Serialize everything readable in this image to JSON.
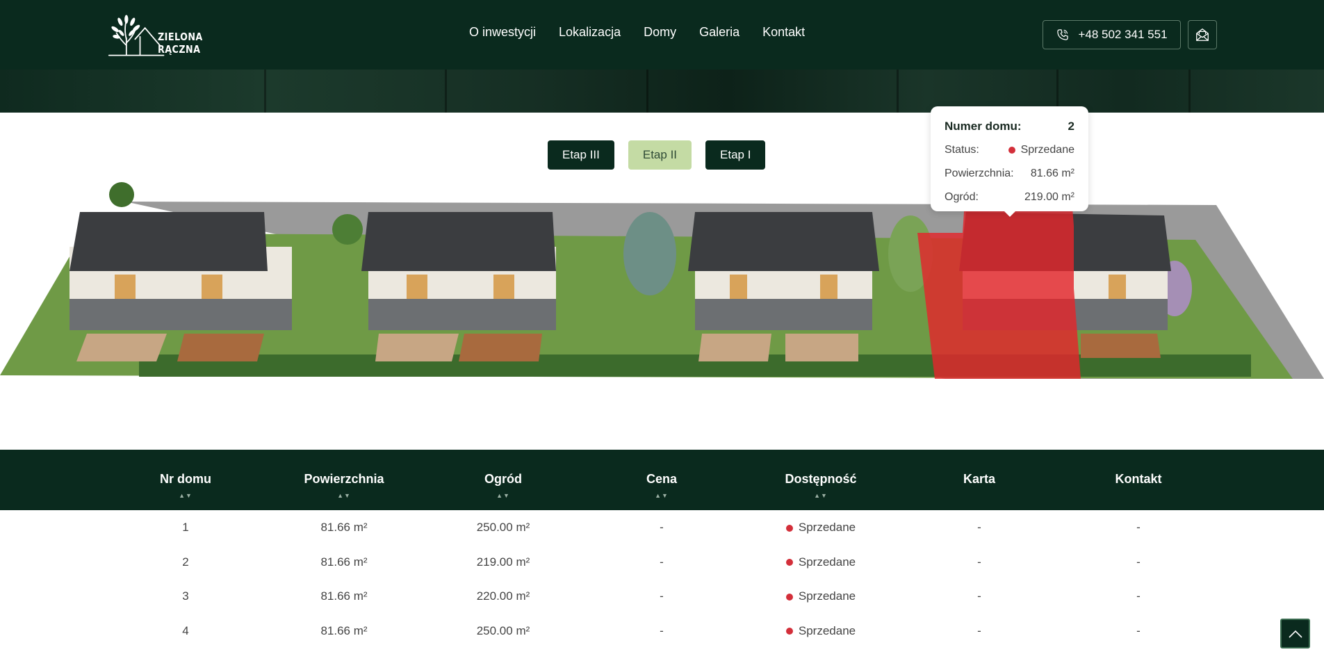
{
  "brand": {
    "name": "ZIELONA RĄCZNA"
  },
  "nav": {
    "items": [
      "O inwestycji",
      "Lokalizacja",
      "Domy",
      "Galeria",
      "Kontakt"
    ]
  },
  "contact": {
    "phone": "+48 502 341 551"
  },
  "tabs": [
    {
      "label": "Etap III",
      "active": false
    },
    {
      "label": "Etap II",
      "active": true
    },
    {
      "label": "Etap I",
      "active": false
    }
  ],
  "tooltip": {
    "house_label": "Numer domu:",
    "house_value": "2",
    "status_label": "Status:",
    "status_value": "Sprzedane",
    "area_label": "Powierzchnia:",
    "area_value": "81.66 m²",
    "garden_label": "Ogród:",
    "garden_value": "219.00 m²"
  },
  "table": {
    "headers": [
      {
        "label": "Nr domu",
        "sortable": true
      },
      {
        "label": "Powierzchnia",
        "sortable": true
      },
      {
        "label": "Ogród",
        "sortable": true
      },
      {
        "label": "Cena",
        "sortable": true
      },
      {
        "label": "Dostępność",
        "sortable": true
      },
      {
        "label": "Karta",
        "sortable": false
      },
      {
        "label": "Kontakt",
        "sortable": false
      }
    ],
    "sort_glyph": "▲▼",
    "rows": [
      {
        "nr": "1",
        "area": "81.66 m²",
        "garden": "250.00 m²",
        "price": "-",
        "status": "Sprzedane",
        "card": "-",
        "contact": "-"
      },
      {
        "nr": "2",
        "area": "81.66 m²",
        "garden": "219.00 m²",
        "price": "-",
        "status": "Sprzedane",
        "card": "-",
        "contact": "-"
      },
      {
        "nr": "3",
        "area": "81.66 m²",
        "garden": "220.00 m²",
        "price": "-",
        "status": "Sprzedane",
        "card": "-",
        "contact": "-"
      },
      {
        "nr": "4",
        "area": "81.66 m²",
        "garden": "250.00 m²",
        "price": "-",
        "status": "Sprzedane",
        "card": "-",
        "contact": "-"
      }
    ]
  },
  "colors": {
    "primary_dark": "#0a2a1e",
    "accent_light": "#c4dba4",
    "sold_red": "#d32f3a"
  },
  "icons": {
    "phone": "phone-icon",
    "mail": "mail-icon",
    "to_top": "chevron-up-icon"
  }
}
